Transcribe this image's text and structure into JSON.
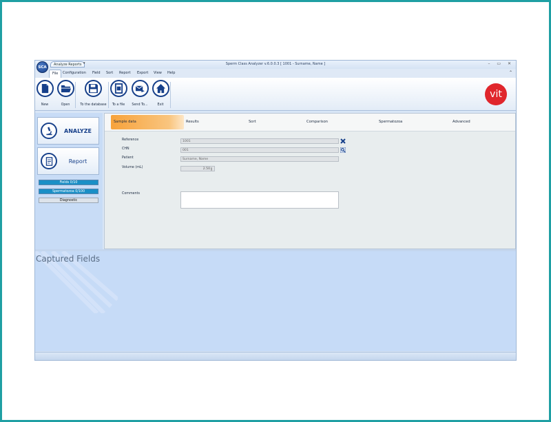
{
  "app": {
    "orb_label": "SCA",
    "context_tab": "Analyze  Reports",
    "qa_pin": "▾",
    "title": "Sperm Class Analyzer v.6.0.0.3 [ 1001 - Surname, Name ]",
    "window_controls": "– ▭ ✕",
    "collapse": "⌃"
  },
  "menu": [
    "File",
    "Configuration",
    "Field",
    "Sort",
    "Report",
    "Export",
    "View",
    "Help"
  ],
  "ribbon": {
    "buttons": [
      "New",
      "Open",
      "To the database",
      "To a file",
      "Send To...",
      "Exit"
    ],
    "brand": "vit"
  },
  "left_panel": {
    "analyze": "ANALYZE",
    "report": "Report",
    "fields": "Fields 0/10",
    "spermatozoa": "Spermatozoa 0/100",
    "diagnostic": "Diagnostic"
  },
  "tabs": [
    "Sample data",
    "Results",
    "Sort",
    "Comparison",
    "Spermatozoa",
    "Advanced"
  ],
  "form": {
    "reference_label": "Reference",
    "reference_value": "1001",
    "chn_label": "CHN",
    "chn_value": "001",
    "patient_label": "Patient",
    "patient_value": "Surname, Name",
    "volume_label": "Volume (mL)",
    "volume_value": "2.50",
    "comments_label": "Comments"
  },
  "captured": {
    "title": "Captured Fields"
  },
  "colors": {
    "accent": "#17408a",
    "tab_active": "#f7a23b",
    "brand": "#e0262c",
    "frame": "#1f9fa3"
  }
}
